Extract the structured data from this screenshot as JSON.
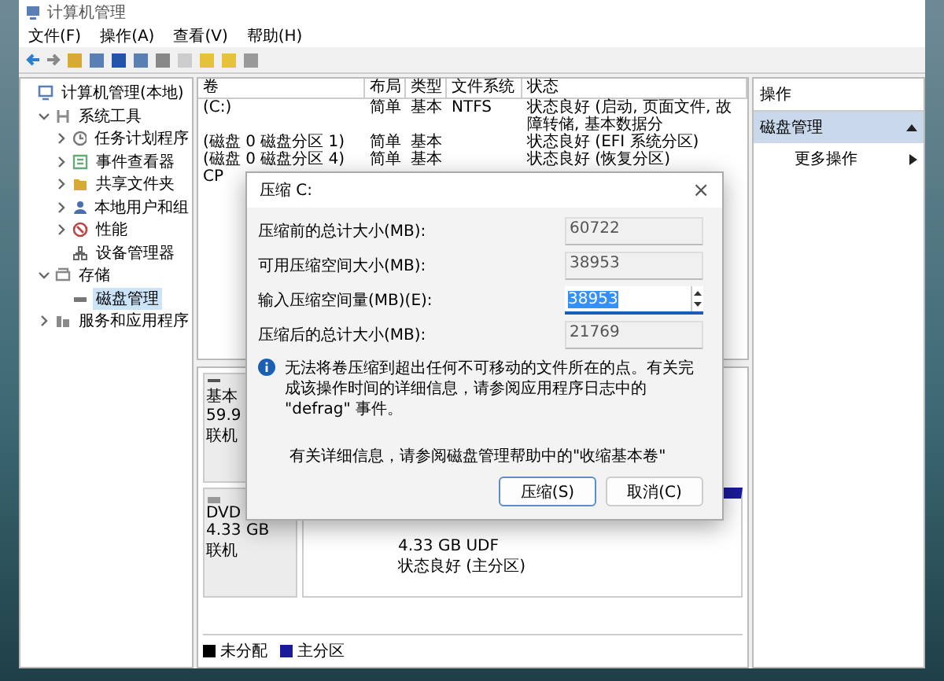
{
  "window": {
    "title": "计算机管理"
  },
  "menu": [
    {
      "label": "文件(F)"
    },
    {
      "label": "操作(A)"
    },
    {
      "label": "查看(V)"
    },
    {
      "label": "帮助(H)"
    }
  ],
  "tree": [
    {
      "label": "计算机管理(本地)",
      "kind": "computer",
      "children": [
        {
          "label": "系统工具",
          "kind": "tools",
          "expanded": true,
          "children": [
            {
              "label": "任务计划程序",
              "kind": "clock",
              "expanded": false
            },
            {
              "label": "事件查看器",
              "kind": "log",
              "expanded": false
            },
            {
              "label": "共享文件夹",
              "kind": "folder",
              "expanded": false
            },
            {
              "label": "本地用户和组",
              "kind": "users",
              "expanded": false
            },
            {
              "label": "性能",
              "kind": "gauge",
              "expanded": false
            },
            {
              "label": "设备管理器",
              "kind": "device"
            }
          ]
        },
        {
          "label": "存储",
          "kind": "storage",
          "expanded": true,
          "children": [
            {
              "label": "磁盘管理",
              "kind": "disk",
              "selected": true
            }
          ]
        },
        {
          "label": "服务和应用程序",
          "kind": "services",
          "expanded": false
        }
      ]
    }
  ],
  "volumes": {
    "columns": [
      "卷",
      "布局",
      "类型",
      "文件系统",
      "状态"
    ],
    "rows": [
      {
        "cells": [
          "(C:)",
          "简单",
          "基本",
          "NTFS",
          "状态良好 (启动, 页面文件, 故障转储, 基本数据分"
        ]
      },
      {
        "cells": [
          "(磁盘 0 磁盘分区 1)",
          "简单",
          "基本",
          "",
          "状态良好 (EFI 系统分区)"
        ]
      },
      {
        "cells": [
          "(磁盘 0 磁盘分区 4)",
          "简单",
          "基本",
          "",
          "状态良好 (恢复分区)"
        ]
      },
      {
        "cells": [
          "CP"
        ]
      }
    ]
  },
  "disks": [
    {
      "kind": "disk",
      "lines": [
        "基本",
        "59.9",
        "联机"
      ]
    },
    {
      "kind": "dvd",
      "lines": [
        "DVD",
        "4.33 GB",
        "联机"
      ],
      "partition": [
        "4.33 GB UDF",
        "状态良好 (主分区)"
      ]
    }
  ],
  "legend": [
    {
      "label": "未分配",
      "color": "#000000"
    },
    {
      "label": "主分区",
      "color": "#1a1a9a"
    }
  ],
  "actions": {
    "title": "操作",
    "section": {
      "label": "磁盘管理",
      "expanded": true
    },
    "items": [
      {
        "label": "更多操作"
      }
    ]
  },
  "dialog": {
    "title": "压缩 C:",
    "close": "×",
    "fields": [
      {
        "label": "压缩前的总计大小(MB):",
        "value": "60722",
        "kind": "readonly"
      },
      {
        "label": "可用压缩空间大小(MB):",
        "value": "38953",
        "kind": "readonly"
      },
      {
        "label": "输入压缩空间量(MB)(E):",
        "value": "38953",
        "kind": "spin"
      },
      {
        "label": "压缩后的总计大小(MB):",
        "value": "21769",
        "kind": "readonly"
      }
    ],
    "info": "无法将卷压缩到超出任何不可移动的文件所在的点。有关完成该操作时间的详细信息，请参阅应用程序日志中的 \"defrag\" 事件。",
    "help": "有关详细信息，请参阅磁盘管理帮助中的\"收缩基本卷\"",
    "buttons": [
      {
        "label": "压缩(S)",
        "default": true
      },
      {
        "label": "取消(C)",
        "default": false
      }
    ]
  }
}
